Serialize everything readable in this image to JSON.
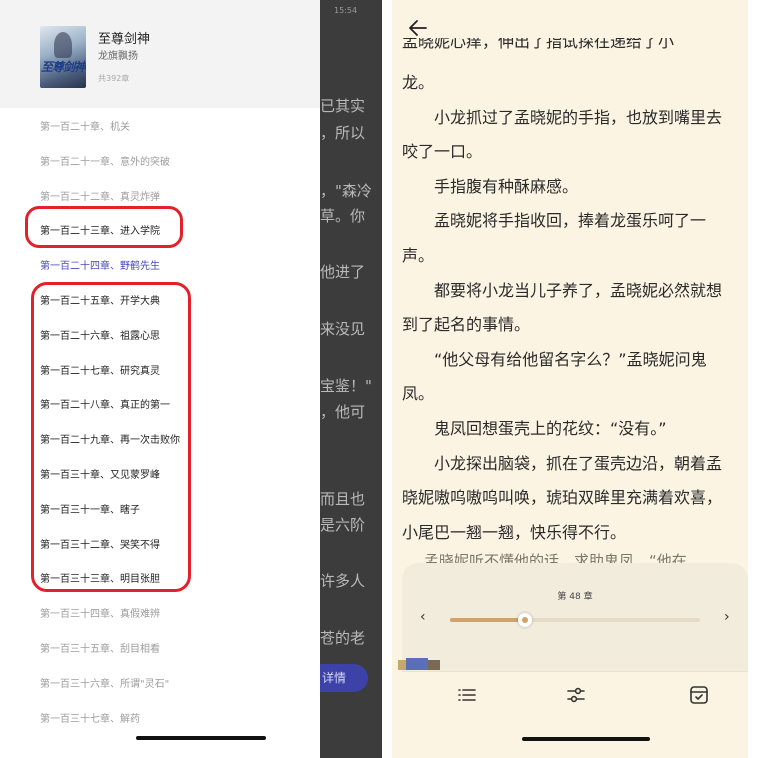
{
  "left_panel": {
    "background_text": {
      "status": "15:54",
      "lines": [
        "已其实",
        "，所以",
        "，\"森冷",
        "草。你",
        "他进了",
        "来没见",
        "宝鉴！\"",
        "，他可",
        "而且也",
        "是六阶",
        "许多人",
        "苍的老"
      ],
      "details_button": "详情"
    },
    "book": {
      "title": "至尊剑神",
      "author": "龙旗飘扬",
      "count": "共392章",
      "cover_text": "至尊剑神"
    },
    "chapters": [
      {
        "label": "第一百二十章、机关",
        "style": "muted"
      },
      {
        "label": "第一百二十一章、意外的突破",
        "style": "muted"
      },
      {
        "label": "第一百二十二章、真灵炸弹",
        "style": "muted"
      },
      {
        "label": "第一百二十三章、进入学院",
        "style": "dark"
      },
      {
        "label": "第一百二十四章、野鹤先生",
        "style": "current"
      },
      {
        "label": "第一百二十五章、开学大典",
        "style": "dark"
      },
      {
        "label": "第一百二十六章、祖露心思",
        "style": "dark"
      },
      {
        "label": "第一百二十七章、研究真灵",
        "style": "dark"
      },
      {
        "label": "第一百二十八章、真正的第一",
        "style": "dark"
      },
      {
        "label": "第一百二十九章、再一次击败你",
        "style": "dark"
      },
      {
        "label": "第一百三十章、又见蒙罗峰",
        "style": "dark"
      },
      {
        "label": "第一百三十一章、瞎子",
        "style": "dark"
      },
      {
        "label": "第一百三十二章、哭笑不得",
        "style": "dark"
      },
      {
        "label": "第一百三十三章、明目张胆",
        "style": "dark"
      },
      {
        "label": "第一百三十四章、真假难辨",
        "style": "muted"
      },
      {
        "label": "第一百三十五章、刮目相看",
        "style": "muted"
      },
      {
        "label": "第一百三十六章、所谓\"灵石\"",
        "style": "muted"
      },
      {
        "label": "第一百三十七章、解药",
        "style": "muted"
      }
    ]
  },
  "right_panel": {
    "first_line_cut": "孟晓妮心痒，伸出了指试探往递给了小",
    "paragraphs": [
      "龙。",
      "　　小龙抓过了孟晓妮的手指，也放到嘴里去",
      "咬了一口。",
      "　　手指腹有种酥麻感。",
      "　　孟晓妮将手指收回，捧着龙蛋乐呵了一",
      "声。",
      "　　都要将小龙当儿子养了，孟晓妮必然就想",
      "到了起名的事情。",
      "　　“他父母有给他留名字么？”孟晓妮问鬼",
      "凤。",
      "　　鬼凤回想蛋壳上的花纹：“没有。”",
      "　　小龙探出脑袋，抓在了蛋壳边沿，朝着孟",
      "晓妮嗷呜嗷呜叫唤，琥珀双眸里充满着欢喜，",
      "小尾巴一翘一翘，快乐得不行。"
    ],
    "hidden_line": "孟晓妮听不懂他的话，求助鬼凤，“他在",
    "slider": {
      "chapter_label": "第 48 章",
      "progress": 0.3,
      "prev": "‹",
      "next": "›"
    },
    "colors": {
      "reader_bg": "#fbf4e3",
      "accent": "#d2a26a",
      "highlight_ring": "#e3212b"
    },
    "toolbar_icons": [
      "list-icon",
      "sliders-icon",
      "bookmark-icon"
    ]
  }
}
